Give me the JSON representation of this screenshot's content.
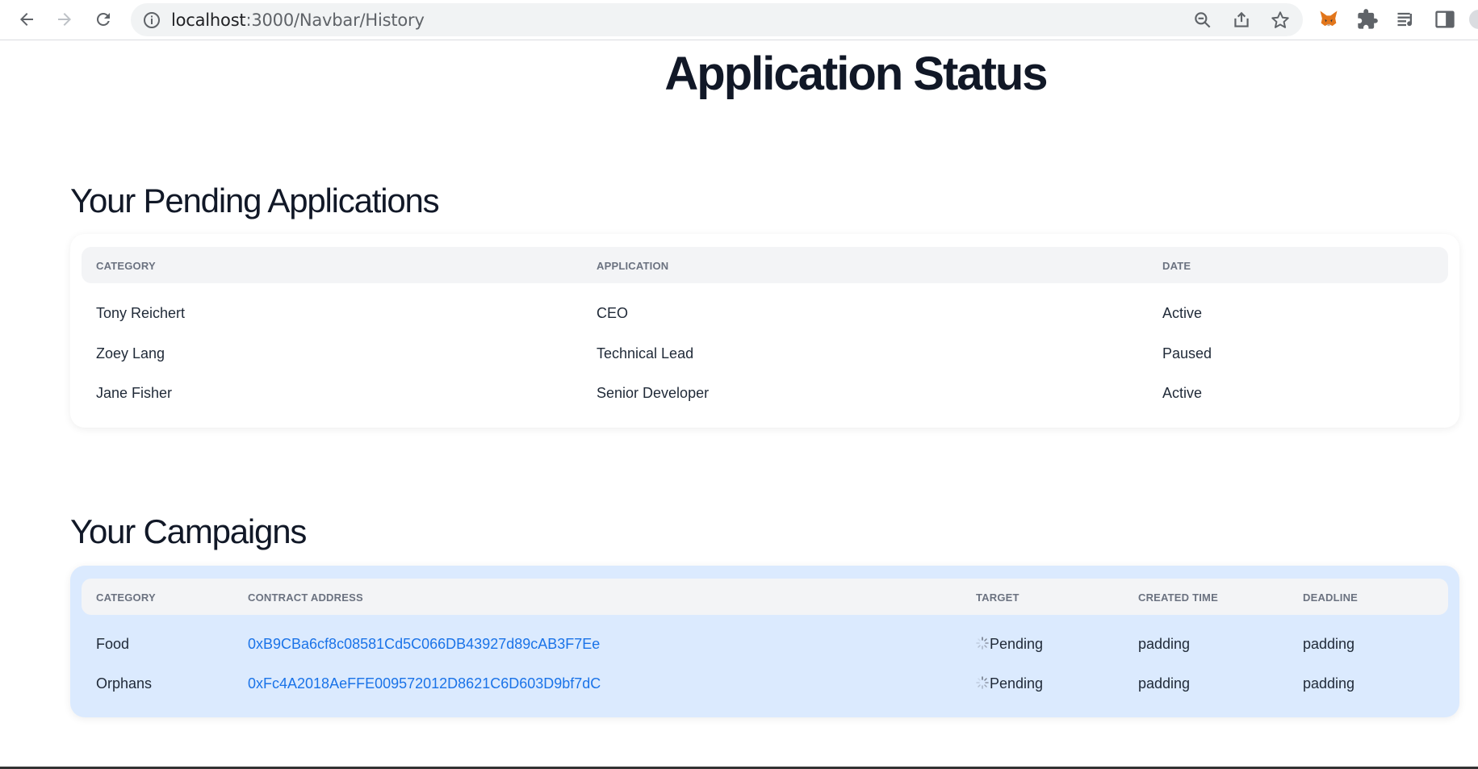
{
  "browser": {
    "url_host": "localhost",
    "url_rest": ":3000/Navbar/History",
    "icons": [
      "back-icon",
      "forward-icon",
      "reload-icon",
      "info-icon",
      "zoom-icon",
      "share-icon",
      "star-icon",
      "metamask-fox-icon",
      "puzzle-icon",
      "media-icon",
      "side-panel-icon"
    ]
  },
  "page": {
    "title": "Application Status"
  },
  "pending": {
    "title": "Your Pending Applications",
    "headers": [
      "CATEGORY",
      "APPLICATION",
      "DATE"
    ],
    "rows": [
      {
        "category": "Tony Reichert",
        "application": "CEO",
        "date": "Active"
      },
      {
        "category": "Zoey Lang",
        "application": "Technical Lead",
        "date": "Paused"
      },
      {
        "category": "Jane Fisher",
        "application": "Senior Developer",
        "date": "Active"
      }
    ]
  },
  "campaigns": {
    "title": "Your Campaigns",
    "headers": [
      "CATEGORY",
      "CONTRACT ADDRESS",
      "TARGET",
      "CREATED TIME",
      "DEADLINE"
    ],
    "rows": [
      {
        "category": "Food",
        "address": "0xB9CBa6cf8c08581Cd5C066DB43927d89cAB3F7Ee",
        "target": "Pending",
        "created": "padding",
        "deadline": "padding"
      },
      {
        "category": "Orphans",
        "address": "0xFc4A2018AeFFE009572012D8621C6D603D9bf7dC",
        "target": "Pending",
        "created": "padding",
        "deadline": "padding"
      }
    ]
  },
  "colors": {
    "link": "#1a73e8",
    "campaign_card_bg": "#dbeafe",
    "table_header_bg": "#f3f4f6"
  }
}
